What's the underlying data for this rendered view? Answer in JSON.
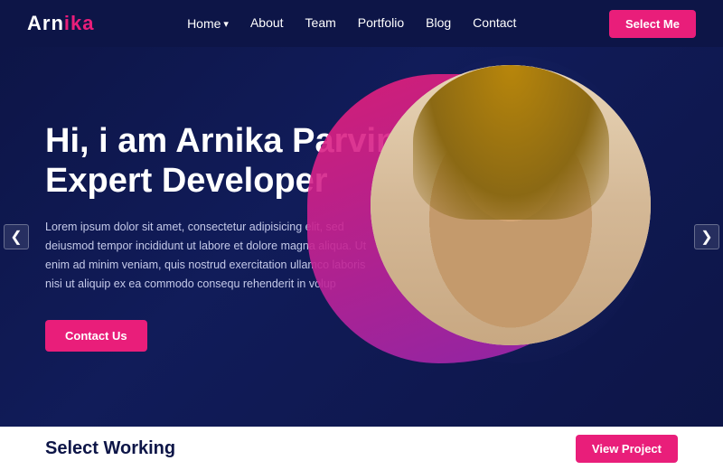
{
  "navbar": {
    "logo_white": "Arn",
    "logo_pink": "ika",
    "nav_items": [
      {
        "label": "Home",
        "has_arrow": true
      },
      {
        "label": "About"
      },
      {
        "label": "Team"
      },
      {
        "label": "Portfolio"
      },
      {
        "label": "Blog"
      },
      {
        "label": "Contact"
      }
    ],
    "select_me_label": "Select Me"
  },
  "hero": {
    "title_line1": "Hi, i am Arnika Parvin",
    "title_line2": "Expert Developer",
    "description": "Lorem ipsum dolor sit amet, consectetur adipisicing elit, sed deiusmod tempor incididunt ut labore et dolore magna aliqua. Ut enim ad minim veniam, quis nostrud exercitation ullamco laboris nisi ut aliquip ex ea commodo consequ rehenderit in volup",
    "contact_btn_label": "Contact Us"
  },
  "nav_arrows": {
    "left": "❮",
    "right": "❯"
  },
  "bottom_strip": {
    "title": "Select Working",
    "view_project_label": "View Project"
  }
}
